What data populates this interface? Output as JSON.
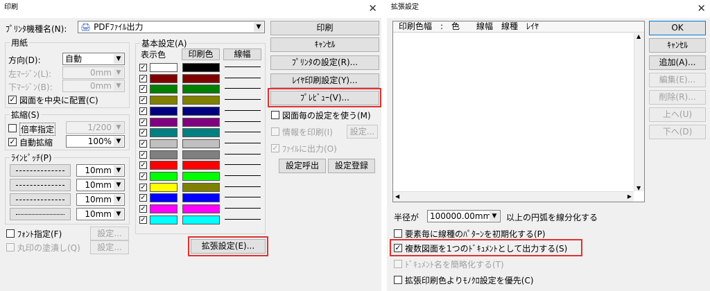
{
  "print_dialog": {
    "title": "印刷",
    "printer_label": "ﾌﾟﾘﾝﾀ機種名(N):",
    "printer_value": "PDFﾌｧｲﾙ出力",
    "paper_group": "用紙",
    "direction_label": "方向(D):",
    "direction_value": "自動",
    "left_margin_label": "左ﾏｰｼﾞﾝ(L):",
    "left_margin_value": "0mm",
    "bottom_margin_label": "下ﾏｰｼﾞﾝ(B):",
    "bottom_margin_value": "0mm",
    "center_label": "図面を中央に配置(C)",
    "scale_group": "拡縮(S)",
    "ratio_label": "倍率指定",
    "ratio_value": "1/200",
    "auto_scale_label": "自動拡縮",
    "auto_scale_value": "100%",
    "pitch_group": "ﾗｲﾝﾋﾟｯﾁ(P)",
    "pitch_values": [
      "10mm",
      "10mm",
      "10mm",
      "10mm"
    ],
    "font_label": "ﾌｫﾝﾄ指定(F)",
    "fill_label": "丸印の塗潰し(Q)",
    "settings_label": "設定...",
    "basic_group": "基本設定(A)",
    "col_display": "表示色",
    "col_print": "印刷色",
    "col_width": "線幅",
    "colors": [
      {
        "display": "#ffffff",
        "print": "#000000"
      },
      {
        "display": "#800000",
        "print": "#800000"
      },
      {
        "display": "#008000",
        "print": "#008000"
      },
      {
        "display": "#808000",
        "print": "#808000"
      },
      {
        "display": "#000080",
        "print": "#000080"
      },
      {
        "display": "#800080",
        "print": "#800080"
      },
      {
        "display": "#008080",
        "print": "#008080"
      },
      {
        "display": "#c0c0c0",
        "print": "#c0c0c0"
      },
      {
        "display": "#808080",
        "print": "#808080"
      },
      {
        "display": "#ff0000",
        "print": "#ff0000"
      },
      {
        "display": "#00ff00",
        "print": "#00ff00"
      },
      {
        "display": "#ffff00",
        "print": "#808000"
      },
      {
        "display": "#0000ff",
        "print": "#0000ff"
      },
      {
        "display": "#ff00ff",
        "print": "#ff00ff"
      },
      {
        "display": "#00ffff",
        "print": "#00ffff"
      }
    ],
    "print_button": "印刷",
    "cancel_button": "ｷｬﾝｾﾙ",
    "printer_settings_button": "ﾌﾟﾘﾝﾀの設定(R)...",
    "layer_print_button": "ﾚｲﾔ印刷設定(Y)...",
    "preview_button": "ﾌﾟﾚﾋﾞｭｰ(V)...",
    "per_drawing_label": "図面毎の設定を使う(M)",
    "print_info_label": "情報を印刷(I)",
    "output_file_label": "ﾌｧｲﾙに出力(O)",
    "load_settings_button": "設定呼出",
    "save_settings_button": "設定登録",
    "extended_button": "拡張設定(E)..."
  },
  "ext_dialog": {
    "title": "拡張設定",
    "list_headers": "印刷色幅　:　色　　線幅　線種　ﾚｲﾔ",
    "ok_button": "OK",
    "cancel_button": "ｷｬﾝｾﾙ",
    "add_button": "追加(A)...",
    "edit_button": "編集(E)...",
    "delete_button": "削除(R)...",
    "up_button": "上へ(U)",
    "down_button": "下へ(D)",
    "radius_label": "半径が",
    "radius_value": "100000.00mm",
    "radius_suffix": "以上の円弧を線分化する",
    "reset_pattern_label": "要素毎に線種のﾊﾟﾀｰﾝを初期化する(P)",
    "multi_doc_label": "複数図面を1つのﾄﾞｷｭﾒﾝﾄとして出力する(S)",
    "simplify_label": "ﾄﾞｷｭﾒﾝﾄ名を簡略化する(T)",
    "mono_label": "拡張印刷色よりﾓﾉｸﾛ設定を優先(C)",
    "check_mark": "✓"
  }
}
